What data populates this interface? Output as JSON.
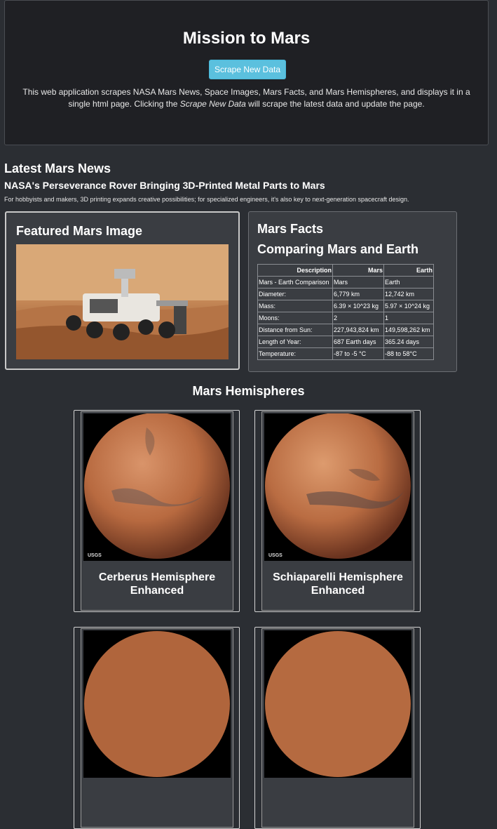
{
  "header": {
    "title": "Mission to Mars",
    "scrape_button": "Scrape New Data",
    "desc_before": "This web application scrapes NASA Mars News, Space Images, Mars Facts, and Mars Hemispheres, and displays it in a single html page. Clicking the ",
    "desc_em": "Scrape New Data",
    "desc_after": " will scrape the latest data and update the page."
  },
  "news": {
    "heading": "Latest Mars News",
    "title": "NASA's Perseverance Rover Bringing 3D-Printed Metal Parts to Mars",
    "teaser": "For hobbyists and makers, 3D printing expands creative possibilities; for specialized engineers, it's also key to next-generation spacecraft design."
  },
  "featured": {
    "heading": "Featured Mars Image"
  },
  "facts": {
    "heading": "Mars Facts",
    "subheading": "Comparing Mars and Earth",
    "columns": [
      "Description",
      "Mars",
      "Earth"
    ],
    "rows": [
      [
        "Mars - Earth Comparison",
        "Mars",
        "Earth"
      ],
      [
        "Diameter:",
        "6,779 km",
        "12,742 km"
      ],
      [
        "Mass:",
        "6.39 × 10^23 kg",
        "5.97 × 10^24 kg"
      ],
      [
        "Moons:",
        "2",
        "1"
      ],
      [
        "Distance from Sun:",
        "227,943,824 km",
        "149,598,262 km"
      ],
      [
        "Length of Year:",
        "687 Earth days",
        "365.24 days"
      ],
      [
        "Temperature:",
        "-87 to -5 °C",
        "-88 to 58°C"
      ]
    ]
  },
  "hemispheres": {
    "heading": "Mars Hemispheres",
    "items": [
      {
        "title": "Cerberus Hemisphere Enhanced",
        "logo": "USGS"
      },
      {
        "title": "Schiaparelli Hemisphere Enhanced",
        "logo": "USGS"
      }
    ]
  }
}
